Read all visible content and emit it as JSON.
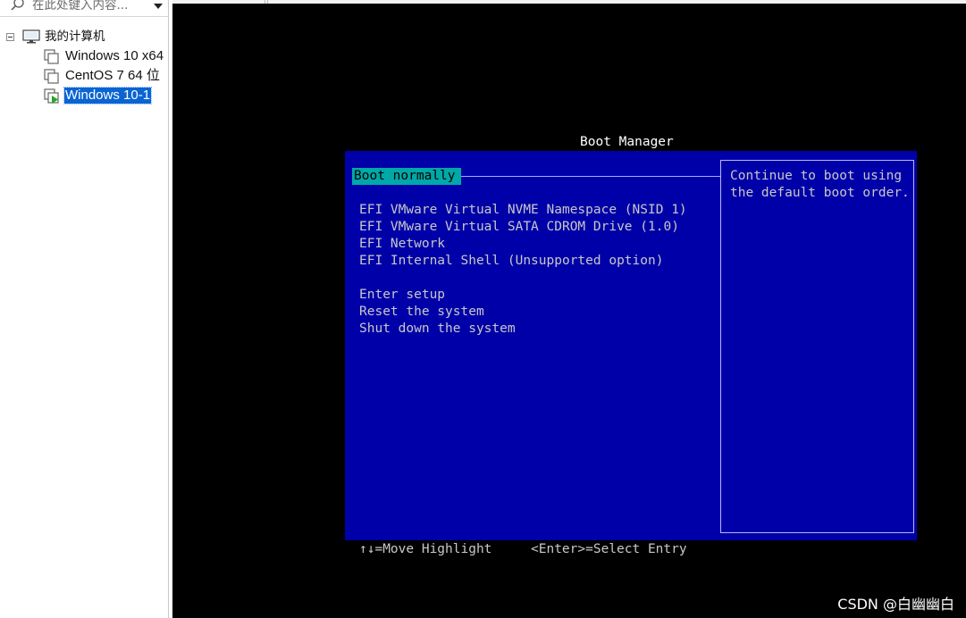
{
  "library": {
    "search_placeholder": "在此处键入内容...",
    "root_label": "我的计算机",
    "vms": [
      {
        "label": "Windows 10 x64",
        "selected": false,
        "running": false
      },
      {
        "label": "CentOS 7 64 位",
        "selected": false,
        "running": false
      },
      {
        "label": "Windows 10-1",
        "selected": true,
        "running": true
      }
    ]
  },
  "boot_manager": {
    "title": "Boot Manager",
    "selected_item": "Boot normally",
    "boot_entries": [
      "EFI VMware Virtual NVME Namespace (NSID 1)",
      "EFI VMware Virtual SATA CDROM Drive (1.0)",
      "EFI Network",
      "EFI Internal Shell (Unsupported option)"
    ],
    "system_actions": [
      "Enter setup",
      "Reset the system",
      "Shut down the system"
    ],
    "help_lines": [
      "Continue to boot using",
      "the default boot order."
    ],
    "key_hints": {
      "move": "↑↓=Move Highlight",
      "select": "<Enter>=Select Entry"
    }
  },
  "watermark": "CSDN @白幽幽白",
  "colors": {
    "bios_background": "#0000a8",
    "bios_highlight": "#00a8a8",
    "bios_text": "#c8c8c8",
    "selection_blue": "#0a64d2",
    "running_green": "#22a822"
  }
}
